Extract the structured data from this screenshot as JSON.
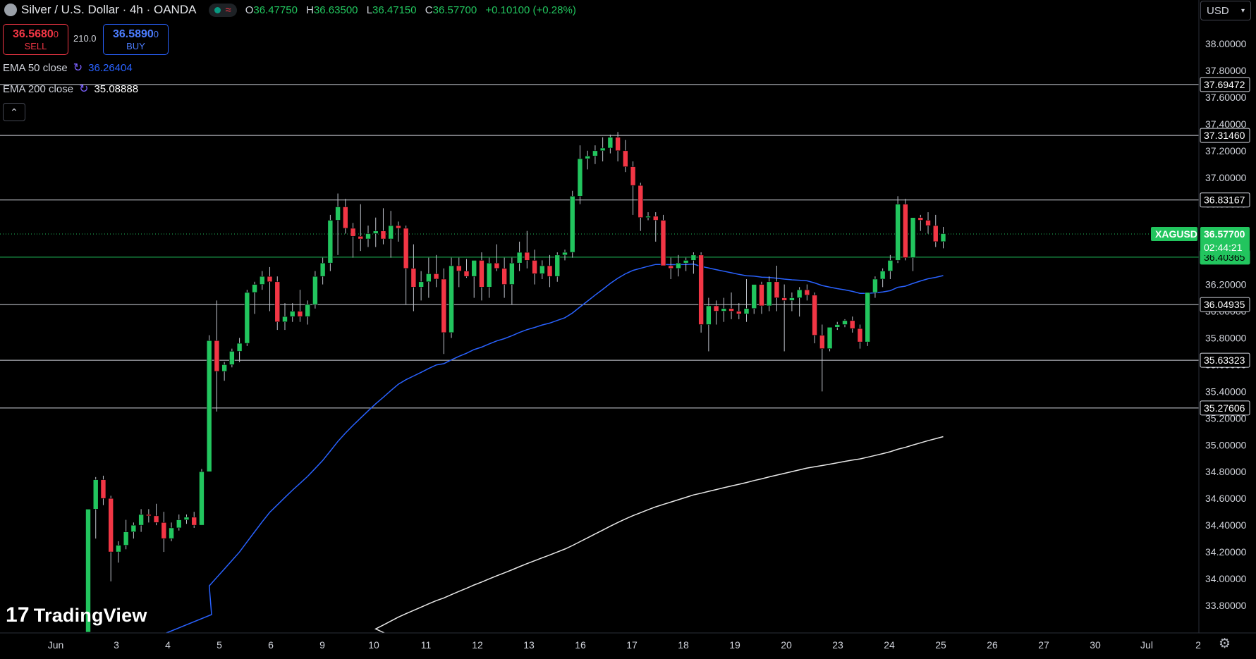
{
  "header": {
    "title": "Silver / U.S. Dollar · 4h · OANDA",
    "ohlc": [
      {
        "key": "O",
        "value": "36.47750"
      },
      {
        "key": "H",
        "value": "36.63500"
      },
      {
        "key": "L",
        "value": "36.47150"
      },
      {
        "key": "C",
        "value": "36.57700"
      },
      {
        "key": "",
        "value": "+0.10100 (+0.28%)"
      }
    ],
    "currency": "USD",
    "colors": {
      "up": "#22c55e",
      "down": "#f23645",
      "accent": "#2962ff"
    }
  },
  "trade": {
    "sell_price": "36.5680",
    "sell_price_small": "0",
    "sell_label": "SELL",
    "spread": "210.0",
    "buy_price": "36.5890",
    "buy_price_small": "0",
    "buy_label": "BUY"
  },
  "indicators": [
    {
      "label": "EMA 50 close",
      "value": "36.26404",
      "color": "#2962ff"
    },
    {
      "label": "EMA 200 close",
      "value": "35.08888",
      "color": "#ffffff"
    }
  ],
  "brand": "TradingView",
  "chart_data": {
    "type": "candlestick",
    "symbol": "XAGUSD",
    "ylim": [
      33.6,
      38.1
    ],
    "y_ticks": [
      "38.00000",
      "37.80000",
      "37.60000",
      "37.40000",
      "37.20000",
      "37.00000",
      "36.80000",
      "36.60000",
      "36.40000",
      "36.20000",
      "36.00000",
      "35.80000",
      "35.60000",
      "35.40000",
      "35.20000",
      "35.00000",
      "34.80000",
      "34.60000",
      "34.40000",
      "34.20000",
      "34.00000",
      "33.80000"
    ],
    "x_ticks": [
      "Jun",
      "3",
      "4",
      "5",
      "6",
      "9",
      "10",
      "11",
      "12",
      "13",
      "16",
      "17",
      "18",
      "19",
      "20",
      "23",
      "24",
      "25",
      "26",
      "27",
      "30",
      "Jul",
      "2"
    ],
    "horizontal_levels": [
      {
        "value": 37.69472,
        "label": "37.69472"
      },
      {
        "value": 37.3146,
        "label": "37.31460"
      },
      {
        "value": 36.83167,
        "label": "36.83167"
      },
      {
        "value": 36.40365,
        "label": "36.40365"
      },
      {
        "value": 36.04935,
        "label": "36.04935"
      },
      {
        "value": 35.63323,
        "label": "35.63323"
      },
      {
        "value": 35.27606,
        "label": "35.27606"
      }
    ],
    "last_price": {
      "value": 36.577,
      "label": "36.57700",
      "countdown": "02:44:21"
    },
    "candles": [
      [
        33.6,
        34.52,
        33.6,
        34.52
      ],
      [
        34.52,
        34.76,
        34.3,
        34.74
      ],
      [
        34.74,
        34.77,
        34.55,
        34.6
      ],
      [
        34.6,
        34.62,
        33.98,
        34.2
      ],
      [
        34.2,
        34.28,
        34.12,
        34.25
      ],
      [
        34.25,
        34.44,
        34.22,
        34.35
      ],
      [
        34.35,
        34.42,
        34.3,
        34.4
      ],
      [
        34.4,
        34.52,
        34.35,
        34.48
      ],
      [
        34.48,
        34.52,
        34.42,
        34.47
      ],
      [
        34.47,
        34.56,
        34.4,
        34.42
      ],
      [
        34.42,
        34.5,
        34.2,
        34.3
      ],
      [
        34.3,
        34.42,
        34.28,
        34.38
      ],
      [
        34.38,
        34.48,
        34.36,
        34.44
      ],
      [
        34.44,
        34.48,
        34.41,
        34.46
      ],
      [
        34.46,
        34.5,
        34.38,
        34.4
      ],
      [
        34.4,
        34.82,
        34.4,
        34.8
      ],
      [
        34.8,
        35.82,
        34.8,
        35.78
      ],
      [
        35.78,
        36.08,
        35.25,
        35.55
      ],
      [
        35.55,
        35.62,
        35.48,
        35.6
      ],
      [
        35.6,
        35.72,
        35.58,
        35.7
      ],
      [
        35.7,
        35.8,
        35.62,
        35.76
      ],
      [
        35.76,
        36.16,
        35.74,
        36.14
      ],
      [
        36.14,
        36.22,
        35.98,
        36.2
      ],
      [
        36.2,
        36.3,
        36.16,
        36.26
      ],
      [
        36.26,
        36.33,
        36.0,
        36.22
      ],
      [
        36.22,
        36.26,
        35.86,
        35.92
      ],
      [
        35.92,
        36.06,
        35.86,
        35.96
      ],
      [
        35.96,
        36.06,
        35.92,
        36.0
      ],
      [
        36.0,
        36.16,
        35.92,
        35.96
      ],
      [
        35.96,
        36.08,
        35.9,
        36.05
      ],
      [
        36.05,
        36.3,
        36.02,
        36.26
      ],
      [
        36.26,
        36.4,
        36.2,
        36.36
      ],
      [
        36.36,
        36.72,
        36.3,
        36.68
      ],
      [
        36.68,
        36.88,
        36.42,
        36.78
      ],
      [
        36.78,
        36.84,
        36.58,
        36.62
      ],
      [
        36.62,
        36.66,
        36.4,
        36.56
      ],
      [
        36.56,
        36.8,
        36.45,
        36.54
      ],
      [
        36.54,
        36.64,
        36.48,
        36.58
      ],
      [
        36.58,
        36.7,
        36.48,
        36.6
      ],
      [
        36.6,
        36.77,
        36.5,
        36.54
      ],
      [
        36.54,
        36.75,
        36.4,
        36.64
      ],
      [
        36.64,
        36.67,
        36.52,
        36.62
      ],
      [
        36.62,
        36.64,
        36.05,
        36.32
      ],
      [
        36.32,
        36.5,
        36.0,
        36.18
      ],
      [
        36.18,
        36.3,
        36.08,
        36.22
      ],
      [
        36.22,
        36.4,
        36.1,
        36.28
      ],
      [
        36.28,
        36.42,
        36.18,
        36.24
      ],
      [
        36.24,
        36.32,
        35.68,
        35.84
      ],
      [
        35.84,
        36.4,
        35.8,
        36.34
      ],
      [
        36.34,
        36.4,
        36.18,
        36.3
      ],
      [
        36.3,
        36.39,
        36.25,
        36.26
      ],
      [
        36.26,
        36.34,
        36.1,
        36.38
      ],
      [
        36.38,
        36.44,
        36.08,
        36.18
      ],
      [
        36.18,
        36.4,
        36.1,
        36.36
      ],
      [
        36.36,
        36.5,
        36.3,
        36.32
      ],
      [
        36.32,
        36.4,
        36.1,
        36.2
      ],
      [
        36.2,
        36.4,
        36.05,
        36.36
      ],
      [
        36.36,
        36.52,
        36.3,
        36.44
      ],
      [
        36.44,
        36.6,
        36.32,
        36.38
      ],
      [
        36.38,
        36.46,
        36.2,
        36.28
      ],
      [
        36.28,
        36.38,
        36.24,
        36.34
      ],
      [
        36.34,
        36.42,
        36.18,
        36.26
      ],
      [
        36.26,
        36.44,
        36.22,
        36.42
      ],
      [
        36.42,
        36.46,
        36.38,
        36.44
      ],
      [
        36.44,
        36.9,
        36.4,
        36.86
      ],
      [
        36.86,
        37.24,
        36.8,
        37.14
      ],
      [
        37.14,
        37.2,
        37.06,
        37.16
      ],
      [
        37.16,
        37.24,
        37.1,
        37.2
      ],
      [
        37.2,
        37.3,
        37.12,
        37.22
      ],
      [
        37.22,
        37.32,
        37.18,
        37.3
      ],
      [
        37.3,
        37.34,
        37.12,
        37.2
      ],
      [
        37.2,
        37.28,
        37.04,
        37.08
      ],
      [
        37.08,
        37.12,
        36.72,
        36.94
      ],
      [
        36.94,
        36.96,
        36.6,
        36.7
      ],
      [
        36.7,
        36.74,
        36.68,
        36.71
      ],
      [
        36.71,
        36.74,
        36.52,
        36.68
      ],
      [
        36.68,
        36.72,
        36.36,
        36.34
      ],
      [
        36.34,
        36.4,
        36.24,
        36.32
      ],
      [
        36.32,
        36.42,
        36.26,
        36.36
      ],
      [
        36.36,
        36.4,
        36.3,
        36.38
      ],
      [
        36.38,
        36.44,
        36.28,
        36.42
      ],
      [
        36.42,
        36.44,
        35.84,
        35.9
      ],
      [
        35.9,
        36.1,
        35.7,
        36.04
      ],
      [
        36.04,
        36.08,
        35.9,
        36.0
      ],
      [
        36.0,
        36.1,
        35.92,
        36.02
      ],
      [
        36.02,
        36.14,
        35.94,
        36.0
      ],
      [
        36.0,
        36.06,
        35.94,
        35.98
      ],
      [
        35.98,
        36.24,
        35.92,
        36.02
      ],
      [
        36.02,
        36.2,
        35.98,
        36.2
      ],
      [
        36.2,
        36.22,
        35.98,
        36.04
      ],
      [
        36.04,
        36.26,
        36.0,
        36.22
      ],
      [
        36.22,
        36.34,
        36.0,
        36.1
      ],
      [
        36.1,
        36.2,
        35.7,
        36.08
      ],
      [
        36.08,
        36.14,
        36.0,
        36.1
      ],
      [
        36.1,
        36.18,
        35.96,
        36.16
      ],
      [
        36.16,
        36.2,
        36.08,
        36.12
      ],
      [
        36.12,
        36.14,
        35.76,
        35.82
      ],
      [
        35.82,
        35.9,
        35.4,
        35.72
      ],
      [
        35.72,
        35.88,
        35.7,
        35.88
      ],
      [
        35.88,
        35.92,
        35.86,
        35.9
      ],
      [
        35.9,
        35.94,
        35.88,
        35.93
      ],
      [
        35.93,
        35.96,
        35.84,
        35.87
      ],
      [
        35.87,
        35.9,
        35.72,
        35.77
      ],
      [
        35.77,
        36.14,
        35.74,
        36.14
      ],
      [
        36.14,
        36.26,
        36.1,
        36.24
      ],
      [
        36.24,
        36.32,
        36.18,
        36.3
      ],
      [
        36.3,
        36.42,
        36.24,
        36.38
      ],
      [
        36.38,
        36.86,
        36.36,
        36.8
      ],
      [
        36.8,
        36.84,
        36.38,
        36.4
      ],
      [
        36.4,
        36.7,
        36.3,
        36.7
      ],
      [
        36.7,
        36.72,
        36.6,
        36.68
      ],
      [
        36.68,
        36.74,
        36.58,
        36.64
      ],
      [
        36.64,
        36.72,
        36.48,
        36.52
      ],
      [
        36.52,
        36.63,
        36.47,
        36.58
      ]
    ]
  }
}
